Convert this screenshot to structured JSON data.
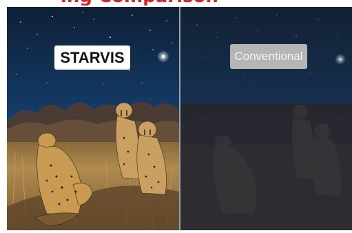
{
  "title_fragment": "ing Comparison",
  "panels": {
    "left": {
      "label": "STARVIS"
    },
    "right": {
      "label": "Conventional"
    }
  }
}
